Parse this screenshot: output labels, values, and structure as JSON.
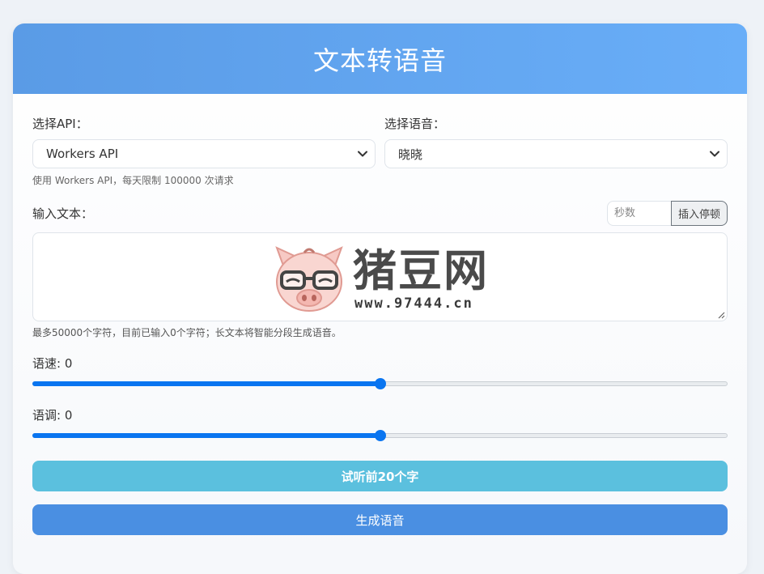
{
  "header": {
    "title": "文本转语音"
  },
  "api": {
    "label": "选择API：",
    "selected": "Workers API",
    "hint": "使用 Workers API，每天限制 100000 次请求"
  },
  "voice": {
    "label": "选择语音：",
    "selected": "晓晓"
  },
  "text_input": {
    "label": "输入文本：",
    "value": "",
    "seconds_placeholder": "秒数",
    "insert_pause_label": "插入停顿",
    "char_hint": "最多50000个字符，目前已输入0个字符；长文本将智能分段生成语音。"
  },
  "watermark": {
    "title": "猪豆网",
    "url": "www.97444.cn"
  },
  "speed": {
    "label": "语速: 0",
    "fraction": 0.5
  },
  "pitch": {
    "label": "语调: 0",
    "fraction": 0.5
  },
  "buttons": {
    "preview_label": "试听前20个字",
    "generate_label": "生成语音"
  },
  "colors": {
    "accent": "#0a75f0",
    "preview_button": "#5bc0de",
    "generate_button": "#4a8fe2"
  }
}
